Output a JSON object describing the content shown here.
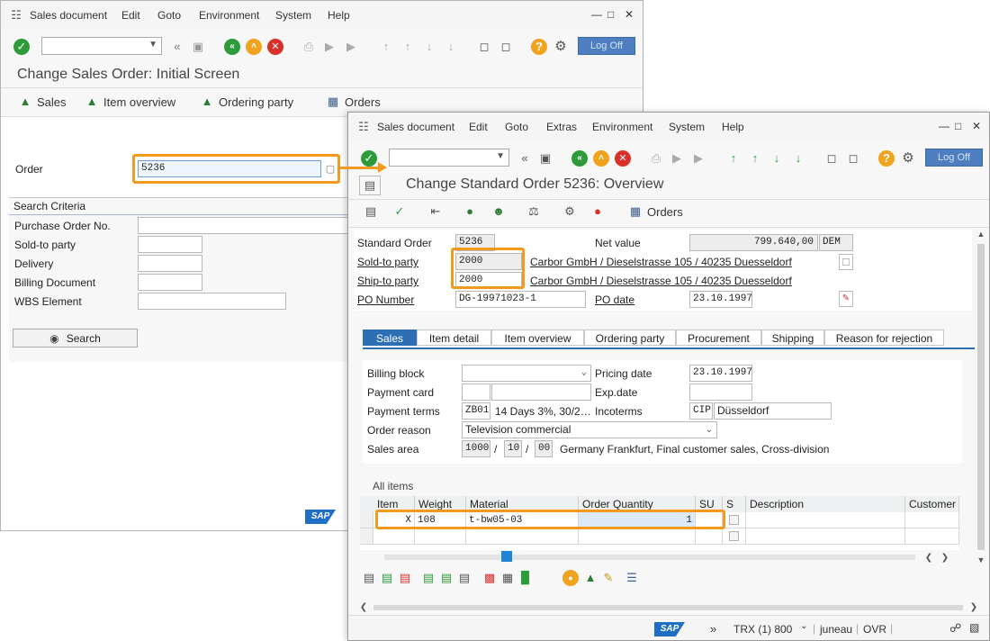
{
  "back_window": {
    "menu": [
      "Sales document",
      "Edit",
      "Goto",
      "Environment",
      "System",
      "Help"
    ],
    "title": "Change Sales Order: Initial Screen",
    "app_toolbar": [
      "Sales",
      "Item overview",
      "Ordering party",
      "Orders"
    ],
    "order_label": "Order",
    "order_value": "5236",
    "search_criteria_title": "Search Criteria",
    "criteria": [
      "Purchase Order No.",
      "Sold-to party",
      "Delivery",
      "Billing Document",
      "WBS Element"
    ],
    "search_button": "Search",
    "logoff_label": "Log Off"
  },
  "front_window": {
    "menu": [
      "Sales document",
      "Edit",
      "Goto",
      "Extras",
      "Environment",
      "System",
      "Help"
    ],
    "title": "Change Standard Order 5236: Overview",
    "orders_button": "Orders",
    "logoff_label": "Log Off",
    "header": {
      "standard_order_label": "Standard Order",
      "standard_order_value": "5236",
      "net_value_label": "Net value",
      "net_value": "799.640,00",
      "currency": "DEM",
      "sold_to_label": "Sold-to party",
      "sold_to_value": "2000",
      "sold_to_name": "Carbor GmbH / Dieselstrasse 105 / 40235 Duesseldorf",
      "ship_to_label": "Ship-to party",
      "ship_to_value": "2000",
      "ship_to_name": "Carbor GmbH / Dieselstrasse 105 / 40235 Duesseldorf",
      "po_number_label": "PO Number",
      "po_number_value": "DG-19971023-1",
      "po_date_label": "PO date",
      "po_date_value": "23.10.1997"
    },
    "tabs": [
      "Sales",
      "Item detail",
      "Item overview",
      "Ordering party",
      "Procurement",
      "Shipping",
      "Reason for rejection"
    ],
    "sales": {
      "billing_block_label": "Billing block",
      "pricing_date_label": "Pricing date",
      "pricing_date_value": "23.10.1997",
      "payment_card_label": "Payment card",
      "exp_date_label": "Exp.date",
      "payment_terms_label": "Payment terms",
      "payment_terms_code": "ZB01",
      "payment_terms_text": "14 Days 3%, 30/2…",
      "incoterms_label": "Incoterms",
      "incoterms_code": "CIP",
      "incoterms_place": "Düsseldorf",
      "order_reason_label": "Order reason",
      "order_reason_value": "Television commercial",
      "sales_area_label": "Sales area",
      "sales_org": "1000",
      "dist_channel": "10",
      "division": "00",
      "sales_area_text": "Germany Frankfurt, Final customer sales, Cross-division",
      "slash": "/"
    },
    "items": {
      "title": "All items",
      "columns": [
        "Item",
        "Weight",
        "Material",
        "Order Quantity",
        "SU",
        "S",
        "Description",
        "Customer"
      ],
      "row": {
        "item_marker": "X",
        "weight": "108",
        "material": "t-bw05-03",
        "quantity": "1"
      }
    },
    "status": {
      "system": "TRX (1) 800",
      "user": "juneau",
      "mode": "OVR"
    }
  },
  "colors": {
    "accent_orange": "#f39a1e",
    "sap_blue": "#2d6fb5",
    "ok_green": "#2e9b3a",
    "nav_orange": "#f0a31e",
    "cancel_red": "#d9302a"
  }
}
